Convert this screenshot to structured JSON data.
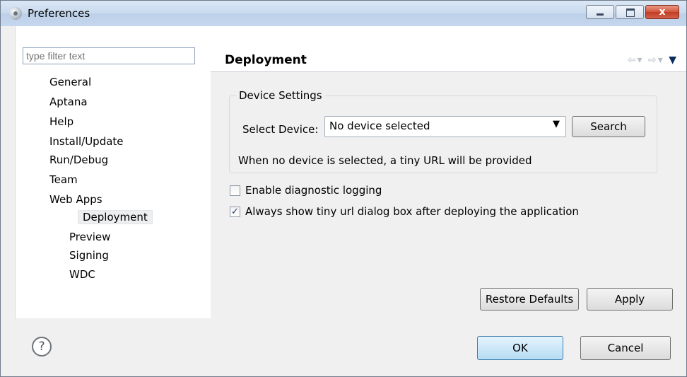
{
  "window": {
    "title": "Preferences",
    "close_label": "x"
  },
  "sidebar": {
    "filter_placeholder": "type filter text",
    "items": [
      "General",
      "Aptana",
      "Help",
      "Install/Update",
      "Run/Debug",
      "Team",
      "Web Apps"
    ],
    "subitems": [
      "Deployment",
      "Preview",
      "Signing",
      "WDC"
    ],
    "selected": "Deployment"
  },
  "page": {
    "title": "Deployment",
    "device_settings": {
      "label": "Device Settings",
      "select_label": "Select Device:",
      "select_value": "No device selected",
      "search_label": "Search",
      "note": "When no device is selected, a tiny URL will be provided"
    },
    "options": [
      {
        "label": "Enable diagnostic logging",
        "checked": false
      },
      {
        "label": "Always show tiny url dialog box after deploying the application",
        "checked": true
      }
    ],
    "restore_defaults_label": "Restore Defaults",
    "apply_label": "Apply"
  },
  "footer": {
    "help_label": "?",
    "ok_label": "OK",
    "cancel_label": "Cancel"
  }
}
